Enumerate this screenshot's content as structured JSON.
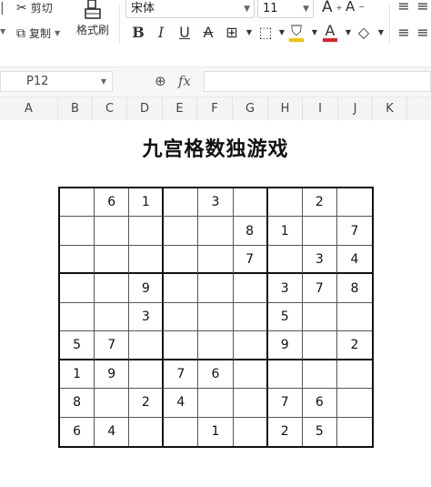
{
  "toolbar": {
    "cut_label": "剪切",
    "copy_label": "复制",
    "format_painter_label": "格式刷",
    "font_name": "宋体",
    "font_size": "11",
    "increase_font": "A",
    "decrease_font": "A",
    "bold": "B",
    "italic": "I",
    "underline": "U",
    "strikethrough": "A",
    "font_color": "A"
  },
  "formula_bar": {
    "cell_ref": "P12",
    "fx": "fx",
    "value": ""
  },
  "columns": [
    "A",
    "B",
    "C",
    "D",
    "E",
    "F",
    "G",
    "H",
    "I",
    "J",
    "K"
  ],
  "sheet": {
    "title": "九宫格数独游戏",
    "sudoku": [
      [
        "",
        "6",
        "1",
        "",
        "3",
        "",
        "",
        "2",
        ""
      ],
      [
        "",
        "",
        "",
        "",
        "",
        "8",
        "1",
        "",
        "7"
      ],
      [
        "",
        "",
        "",
        "",
        "",
        "7",
        "",
        "3",
        "4"
      ],
      [
        "",
        "",
        "9",
        "",
        "",
        "",
        "3",
        "7",
        "8"
      ],
      [
        "",
        "",
        "3",
        "",
        "",
        "",
        "5",
        "",
        ""
      ],
      [
        "5",
        "7",
        "",
        "",
        "",
        "",
        "9",
        "",
        "2"
      ],
      [
        "1",
        "9",
        "",
        "7",
        "6",
        "",
        "",
        "",
        ""
      ],
      [
        "8",
        "",
        "2",
        "4",
        "",
        "",
        "7",
        "6",
        ""
      ],
      [
        "6",
        "4",
        "",
        "",
        "1",
        "",
        "2",
        "5",
        ""
      ]
    ]
  },
  "colors": {
    "fill_color_bar": "#f5c400",
    "font_color_bar": "#e02020"
  }
}
